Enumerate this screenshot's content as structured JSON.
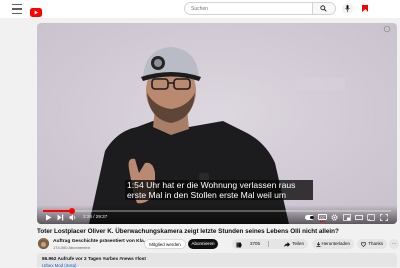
{
  "header": {
    "search_placeholder": "Suchen"
  },
  "player": {
    "subtitles": [
      "1:54 Uhr hat er die Wohnung verlassen raus",
      "erste Mal in den Stollen erste Mal weil um"
    ],
    "time": "2:28 / 29:37",
    "progress": 0.083
  },
  "video": {
    "title": "Toter Lostplacer Oliver K. Überwachungskamera zeigt letzte Stunden seines Lebens Olli nicht allein?",
    "channel_name": "Auftrag Geschichte präsentiert von Kla...",
    "subscribers": "174.000 Abonnenten",
    "member_label": "Mitglied werden",
    "subscribe_label": "Abonnieren",
    "likes": "3705",
    "share_label": "Teilen",
    "download_label": "Herunterladen",
    "thanks_label": "Thanks",
    "more_label": "···"
  },
  "description": {
    "meta": "86.962 Aufrufe  vor 2 Tagen  #urbex #news #lost",
    "link": "Urbex Mod (Insta)"
  },
  "colors": {
    "accent": "#ff0000",
    "subscribe_bg": "#0f0f0f",
    "wall": "#ddd5df"
  }
}
